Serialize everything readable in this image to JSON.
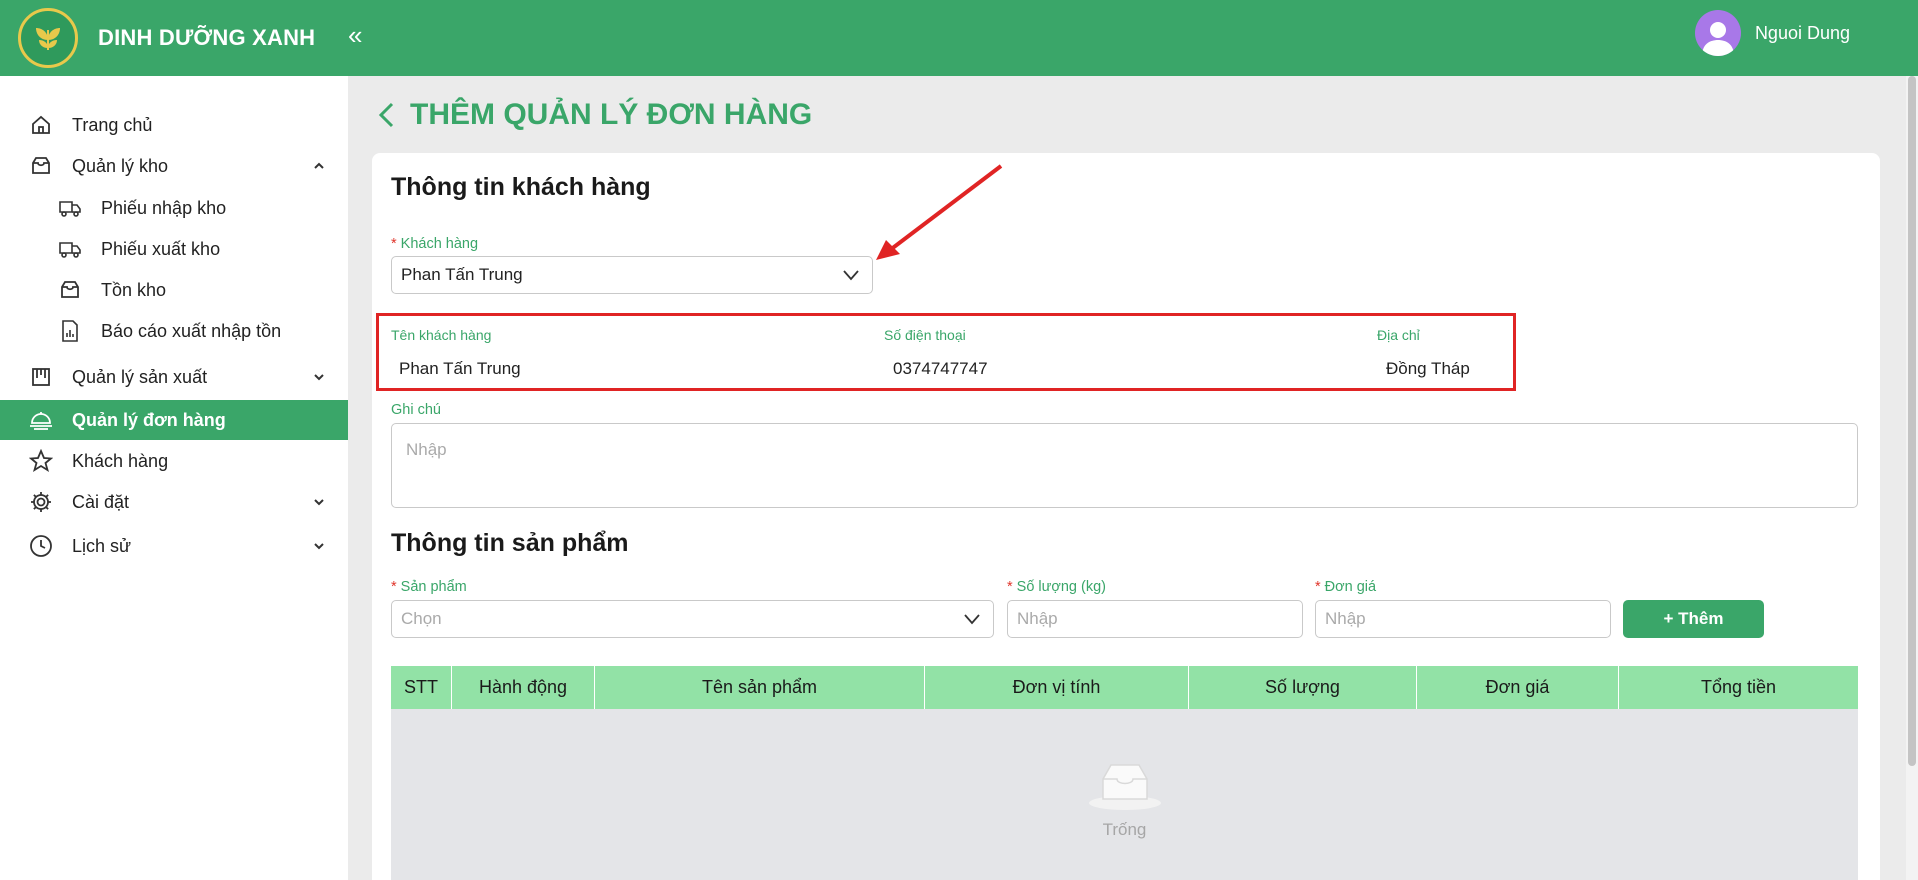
{
  "app": {
    "brand": "DINH DƯỠNG XANH",
    "collapse_icon": "«"
  },
  "user": {
    "name": "Nguoi Dung"
  },
  "sidebar": {
    "items": [
      {
        "label": "Trang chủ",
        "icon": "home-icon"
      },
      {
        "label": "Quản lý kho",
        "icon": "inbox-icon",
        "expanded": true
      },
      {
        "label": "Phiếu nhập kho",
        "icon": "truck-icon"
      },
      {
        "label": "Phiếu xuất kho",
        "icon": "truck-icon"
      },
      {
        "label": "Tồn kho",
        "icon": "inbox-icon"
      },
      {
        "label": "Báo cáo xuất nhập tồn",
        "icon": "report-icon"
      },
      {
        "label": "Quản lý sản xuất",
        "icon": "factory-icon"
      },
      {
        "label": "Quản lý đơn hàng",
        "icon": "dish-icon",
        "active": true
      },
      {
        "label": "Khách hàng",
        "icon": "star-icon"
      },
      {
        "label": "Cài đặt",
        "icon": "gear-icon"
      },
      {
        "label": "Lịch sử",
        "icon": "clock-icon"
      }
    ]
  },
  "page": {
    "title": "THÊM QUẢN LÝ ĐƠN HÀNG"
  },
  "customer_section": {
    "title": "Thông tin khách hàng",
    "customer_label": "Khách hàng",
    "customer_value": "Phan Tấn Trung",
    "details": {
      "name_label": "Tên khách hàng",
      "name_value": "Phan Tấn Trung",
      "phone_label": "Số điện thoại",
      "phone_value": "0374747747",
      "address_label": "Địa chỉ",
      "address_value": "Đồng Tháp"
    },
    "note_label": "Ghi chú",
    "note_placeholder": "Nhập"
  },
  "product_section": {
    "title": "Thông tin sản phẩm",
    "product_label": "Sản phẩm",
    "product_placeholder": "Chọn",
    "qty_label": "Số lượng (kg)",
    "qty_placeholder": "Nhập",
    "price_label": "Đơn giá",
    "price_placeholder": "Nhập",
    "add_button": "+ Thêm"
  },
  "table": {
    "columns": [
      "STT",
      "Hành động",
      "Tên sản phẩm",
      "Đơn vị tính",
      "Số lượng",
      "Đơn giá",
      "Tổng tiền"
    ],
    "empty_text": "Trống"
  },
  "colors": {
    "primary": "#3aa669",
    "table_header": "#92e2a6",
    "highlight": "#e02424"
  }
}
